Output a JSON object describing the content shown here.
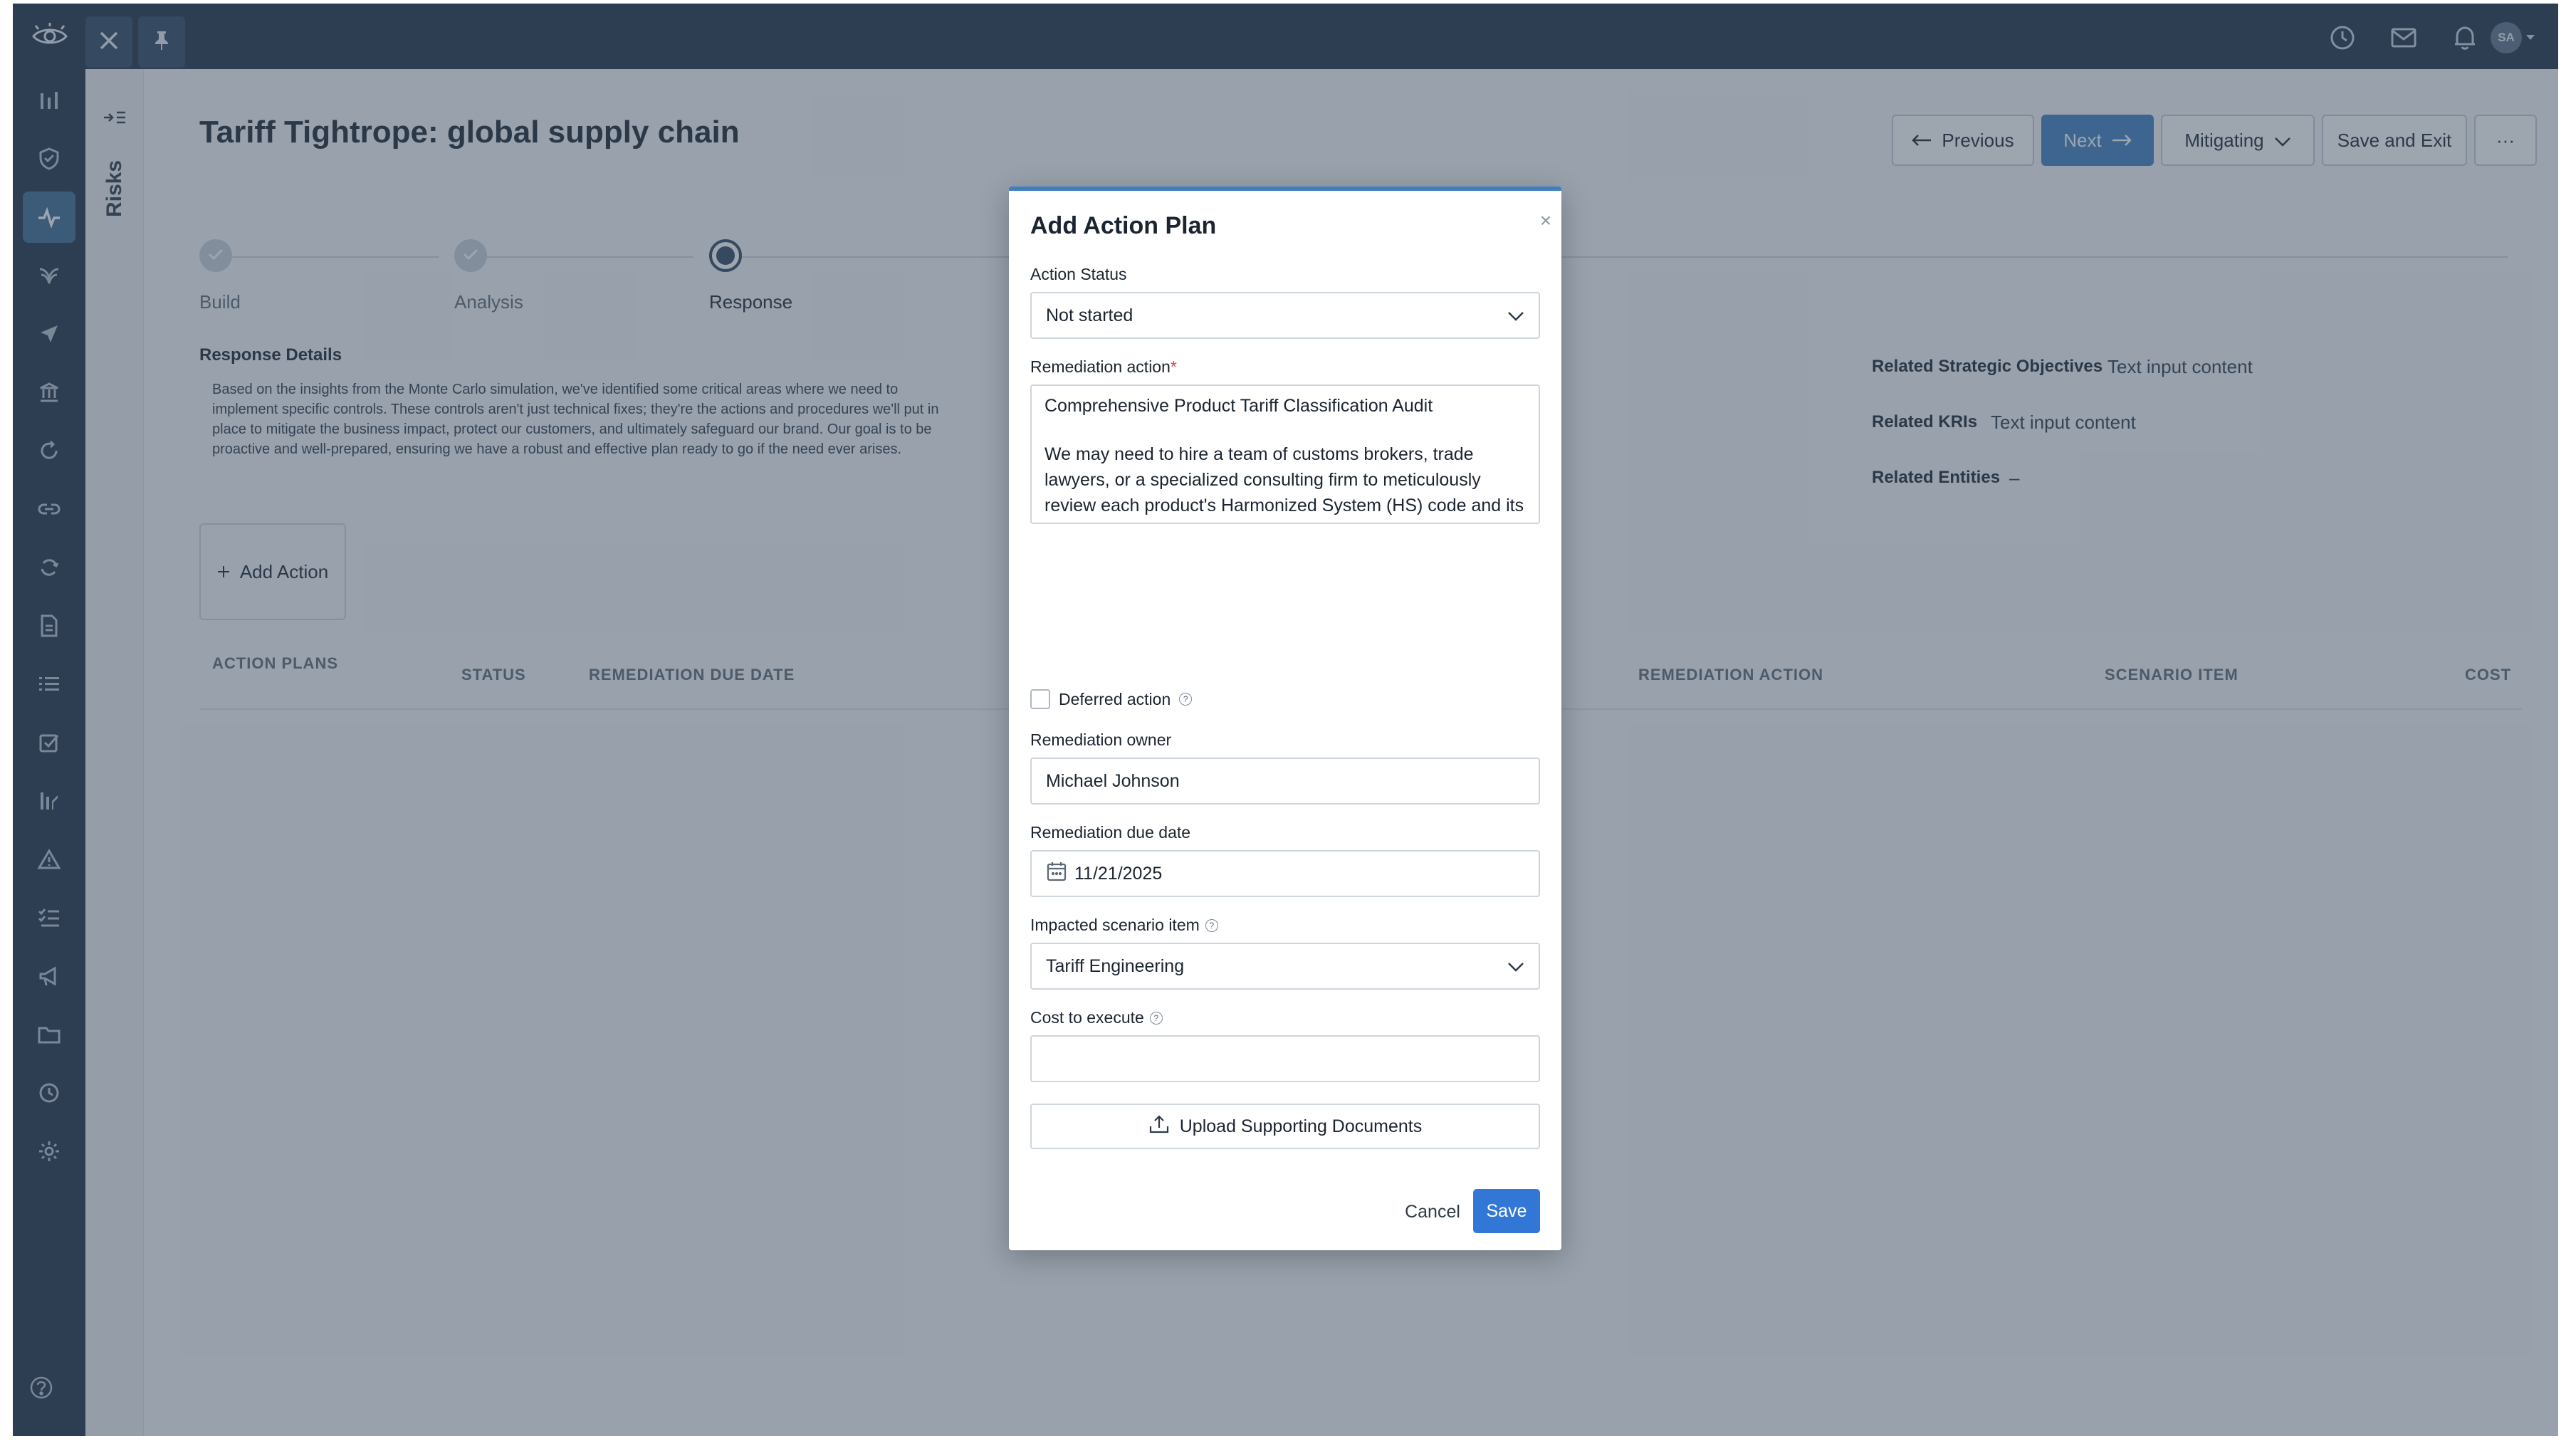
{
  "top_nav": {
    "logo_icon": "eye-logo-icon",
    "close_icon": "close-icon",
    "pin_icon": "pin-icon",
    "right_icons": [
      "clock-icon",
      "mail-icon",
      "bell-icon"
    ],
    "avatar_initials": "SA"
  },
  "side_rail": {
    "items": [
      "bar-chart-icon",
      "shield-check-icon",
      "activity-icon",
      "leaf-icon",
      "send-icon",
      "bank-icon",
      "refresh-icon",
      "link-icon",
      "cycle-icon",
      "document-icon",
      "list-icon",
      "checkbox-icon",
      "ranking-icon",
      "warning-icon",
      "checklist-icon",
      "megaphone-icon",
      "folder-icon",
      "history-icon",
      "settings-icon"
    ],
    "active_index": 2,
    "help_icon": "help-circle-icon"
  },
  "panel": {
    "label": "Risks",
    "toggle_icon": "expand-panel-icon"
  },
  "page": {
    "title": "Tariff Tightrope: global supply chain",
    "buttons": {
      "previous": "Previous",
      "next": "Next",
      "mitigating": "Mitigating",
      "save_exit": "Save and Exit",
      "more": "···"
    }
  },
  "stepper": {
    "steps": [
      {
        "label": "Build",
        "state": "done"
      },
      {
        "label": "Analysis",
        "state": "done"
      },
      {
        "label": "Response",
        "state": "current"
      }
    ]
  },
  "response": {
    "title": "Response Details",
    "body": "Based on the insights from the Monte Carlo simulation, we've identified some critical areas where we need to implement specific controls. These controls aren't just technical fixes; they're the actions and procedures we'll put in place to mitigate the business impact, protect our customers, and ultimately safeguard our brand. Our goal is to be proactive and well-prepared, ensuring we have a robust and effective plan ready to go if the need ever arises.",
    "add_action": "Add Action"
  },
  "related": {
    "objectives_label": "Related Strategic Objectives",
    "objectives_value": "Text input content",
    "kris_label": "Related KRIs",
    "kris_value": "Text input content",
    "entities_label": "Related Entities",
    "entities_value": "–"
  },
  "table": {
    "headers": {
      "action_plans": "ACTION PLANS",
      "status": "STATUS",
      "due_date": "REMEDIATION DUE DATE",
      "remediation_action": "REMEDIATION ACTION",
      "scenario_item": "SCENARIO ITEM",
      "cost": "COST"
    }
  },
  "modal": {
    "title": "Add Action Plan",
    "status_label": "Action Status",
    "status_value": "Not started",
    "remediation_label": "Remediation action",
    "required_mark": "*",
    "remediation_line1": "Comprehensive Product Tariff Classification Audit",
    "remediation_line2": "We may need to hire a team of customs brokers, trade lawyers, or a specialized consulting firm to meticulously review each product's Harmonized System (HS) code and its",
    "deferred_label": "Deferred action",
    "owner_label": "Remediation owner",
    "owner_value": "Michael Johnson",
    "due_label": "Remediation due date",
    "due_value": "11/21/2025",
    "scenario_label": "Impacted scenario item",
    "scenario_value": "Tariff Engineering",
    "cost_label": "Cost to execute",
    "cost_value": "",
    "upload": "Upload Supporting Documents",
    "cancel": "Cancel",
    "save": "Save",
    "help_mark": "?",
    "close_mark": "×"
  },
  "colors": {
    "nav_bg": "#1e2f45",
    "accent": "#3f7fc0",
    "save_button": "#3377d6",
    "overlay": "rgba(60,75,96,0.5)"
  }
}
